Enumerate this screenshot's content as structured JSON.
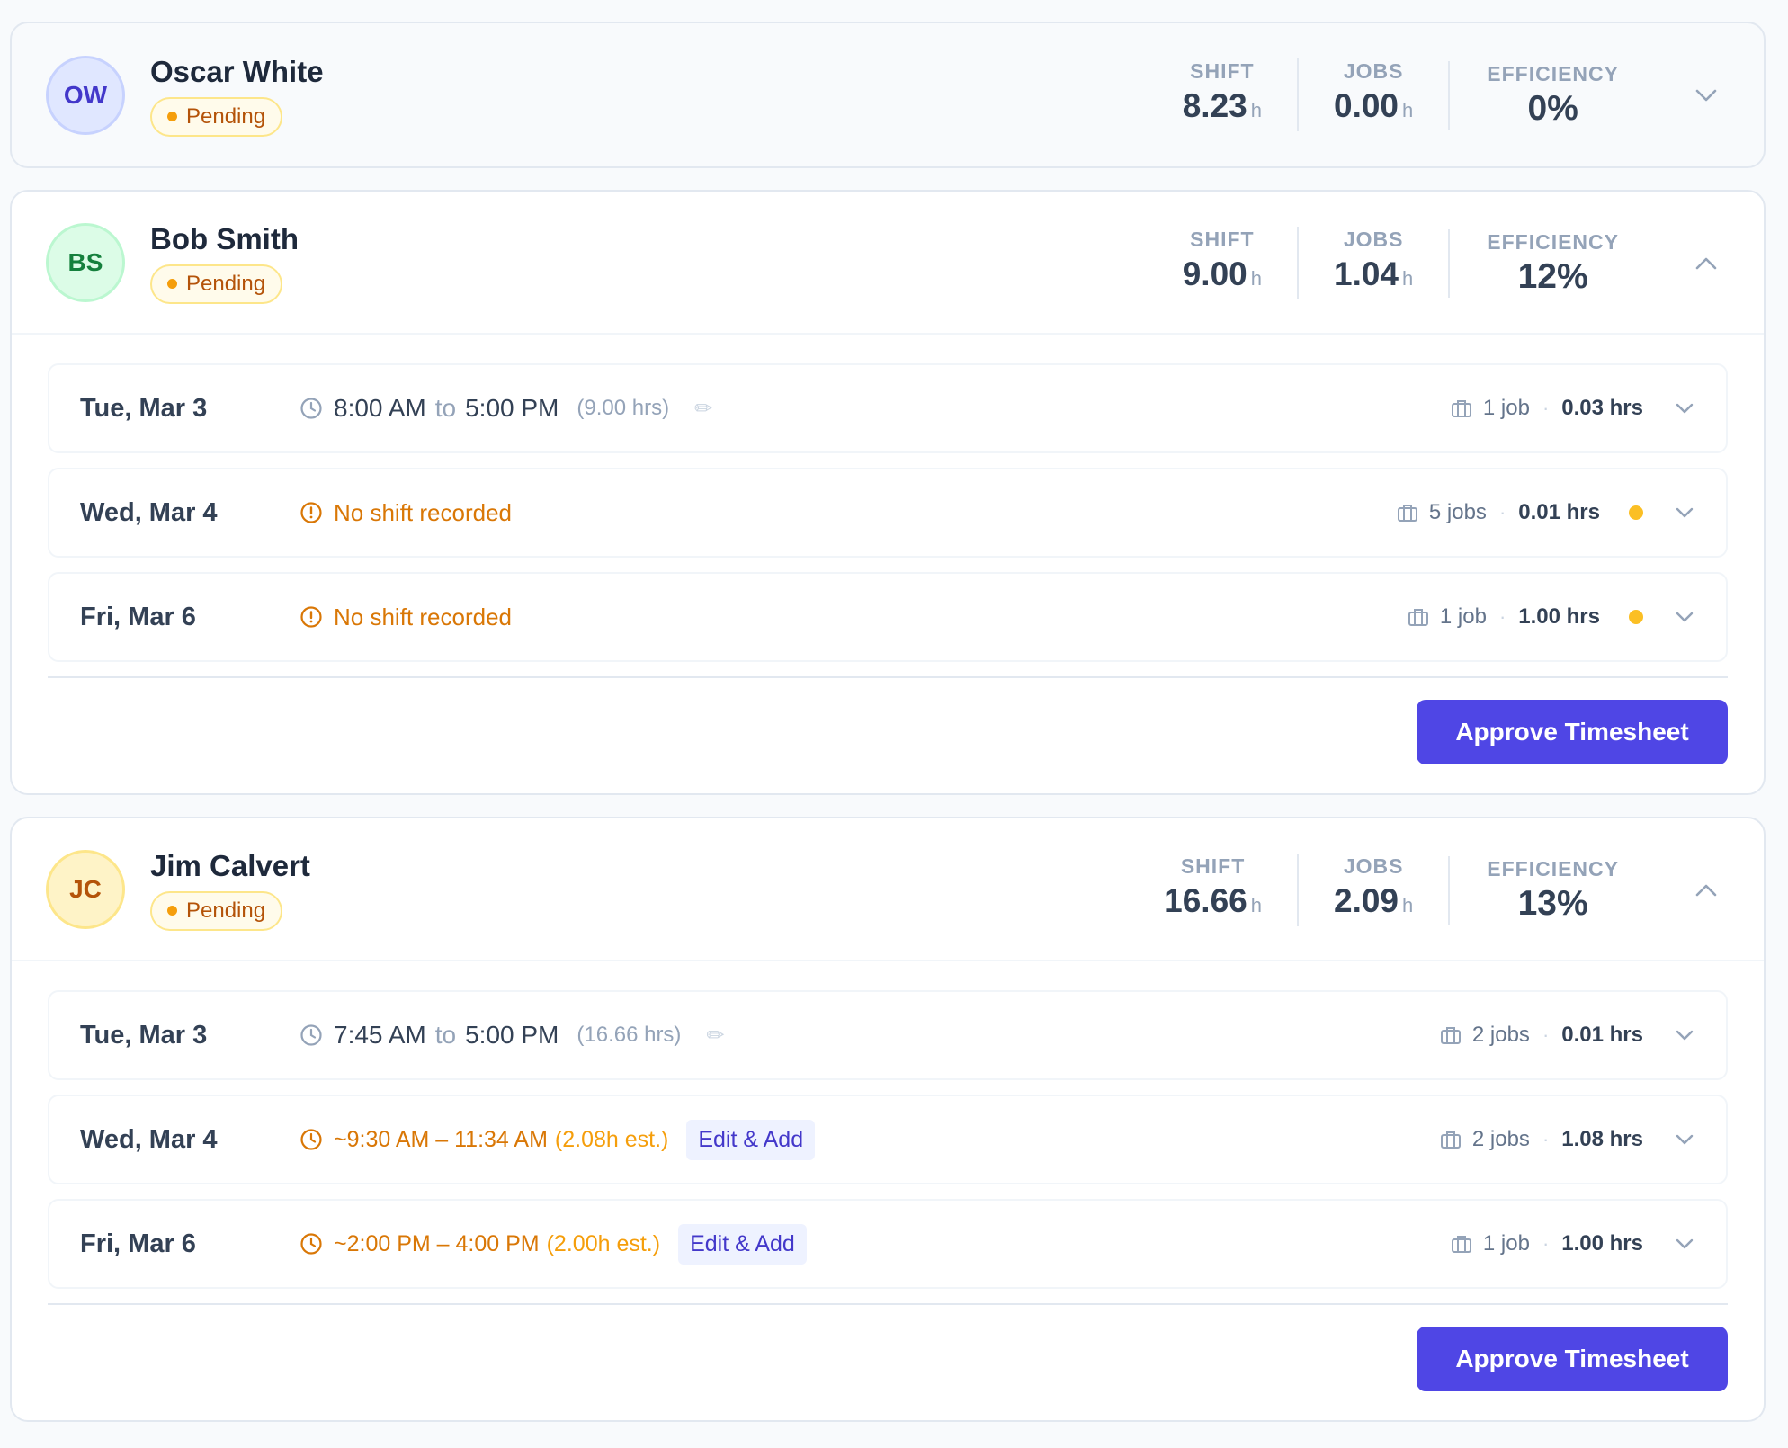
{
  "employees": [
    {
      "initials": "OW",
      "name": "Oscar White",
      "status": "Pending",
      "stats": {
        "shift_label": "SHIFT",
        "shift_value": "8.23",
        "shift_unit": "h",
        "jobs_label": "JOBS",
        "jobs_value": "0.00",
        "jobs_unit": "h",
        "efficiency_label": "EFFICIENCY",
        "efficiency_value": "0%"
      },
      "expanded": false
    },
    {
      "initials": "BS",
      "name": "Bob Smith",
      "status": "Pending",
      "stats": {
        "shift_label": "SHIFT",
        "shift_value": "9.00",
        "shift_unit": "h",
        "jobs_label": "JOBS",
        "jobs_value": "1.04",
        "jobs_unit": "h",
        "efficiency_label": "EFFICIENCY",
        "efficiency_value": "12%"
      },
      "expanded": true,
      "days": [
        {
          "date": "Tue, Mar 3",
          "start": "8:00 AM",
          "to": "to",
          "end": "5:00 PM",
          "hours": "(9.00 hrs)",
          "edit_icon": "✏",
          "jobs": "1 job",
          "dot_sep": "·",
          "job_hours": "0.03 hrs"
        },
        {
          "date": "Wed, Mar 4",
          "warning": "No shift recorded",
          "jobs": "5 jobs",
          "dot_sep": "·",
          "job_hours": "0.01 hrs"
        },
        {
          "date": "Fri, Mar 6",
          "warning": "No shift recorded",
          "jobs": "1 job",
          "dot_sep": "·",
          "job_hours": "1.00 hrs"
        }
      ],
      "approve_label": "Approve Timesheet"
    },
    {
      "initials": "JC",
      "name": "Jim Calvert",
      "status": "Pending",
      "stats": {
        "shift_label": "SHIFT",
        "shift_value": "16.66",
        "shift_unit": "h",
        "jobs_label": "JOBS",
        "jobs_value": "2.09",
        "jobs_unit": "h",
        "efficiency_label": "EFFICIENCY",
        "efficiency_value": "13%"
      },
      "expanded": true,
      "days": [
        {
          "date": "Tue, Mar 3",
          "start": "7:45 AM",
          "to": "to",
          "end": "5:00 PM",
          "hours": "(16.66 hrs)",
          "edit_icon": "✏",
          "jobs": "2 jobs",
          "dot_sep": "·",
          "job_hours": "0.01 hrs"
        },
        {
          "date": "Wed, Mar 4",
          "estimate": "~9:30 AM – 11:34 AM",
          "estimate_note": "(2.08h est.)",
          "edit_add": "Edit & Add",
          "jobs": "2 jobs",
          "dot_sep": "·",
          "job_hours": "1.08 hrs"
        },
        {
          "date": "Fri, Mar 6",
          "estimate": "~2:00 PM – 4:00 PM",
          "estimate_note": "(2.00h est.)",
          "edit_add": "Edit & Add",
          "jobs": "1 job",
          "dot_sep": "·",
          "job_hours": "1.00 hrs"
        }
      ],
      "approve_label": "Approve Timesheet"
    }
  ],
  "icons": {
    "clock": "clock-icon",
    "warning": "alert-circle-icon",
    "briefcase": "briefcase-icon",
    "chevron_down": "chevron-down-icon",
    "chevron_up": "chevron-up-icon",
    "pencil": "pencil-icon"
  },
  "colors": {
    "accent": "#4f46e5",
    "pending": "#b45309",
    "warning": "#d97706",
    "flag": "#fbbf24"
  }
}
